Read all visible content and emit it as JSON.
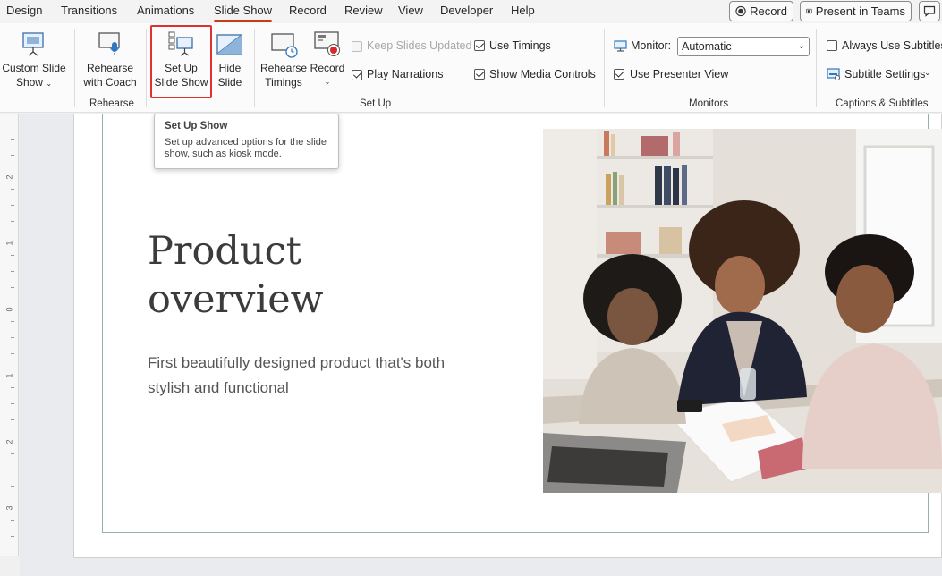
{
  "tabs": [
    {
      "label": "Design"
    },
    {
      "label": "Transitions"
    },
    {
      "label": "Animations"
    },
    {
      "label": "Slide Show"
    },
    {
      "label": "Record"
    },
    {
      "label": "Review"
    },
    {
      "label": "View"
    },
    {
      "label": "Developer"
    },
    {
      "label": "Help"
    }
  ],
  "top_buttons": {
    "record": "Record",
    "present_in_teams": "Present in Teams"
  },
  "ribbon": {
    "custom_slide_show": {
      "line1": "Custom Slide",
      "line2": "Show"
    },
    "rehearse_with_coach": {
      "line1": "Rehearse",
      "line2": "with Coach"
    },
    "set_up_slide_show": {
      "line1": "Set Up",
      "line2": "Slide Show"
    },
    "hide_slide": {
      "line1": "Hide",
      "line2": "Slide"
    },
    "rehearse_timings": {
      "line1": "Rehearse",
      "line2": "Timings"
    },
    "record": {
      "line1": "Record"
    },
    "keep_slides_updated": "Keep Slides Updated",
    "use_timings": "Use Timings",
    "play_narrations": "Play Narrations",
    "show_media_controls": "Show Media Controls",
    "monitor_label": "Monitor:",
    "monitor_value": "Automatic",
    "use_presenter_view": "Use Presenter View",
    "always_use_subtitles": "Always Use Subtitles",
    "subtitle_settings": "Subtitle Settings",
    "groups": {
      "rehearse": "Rehearse",
      "set_up": "Set Up",
      "monitors": "Monitors",
      "captions": "Captions & Subtitles"
    }
  },
  "tooltip": {
    "title": "Set Up Show",
    "body": "Set up advanced options for the slide show, such as kiosk mode."
  },
  "ruler_numbers": [
    "2",
    "1",
    "0",
    "1",
    "2",
    "3"
  ],
  "slide": {
    "title_line1": "Product",
    "title_line2": "overview",
    "subtitle": "First beautifully designed product that's both stylish and functional"
  },
  "colors": {
    "accent_underline": "#c43e1c",
    "highlight_box": "#e03030"
  }
}
